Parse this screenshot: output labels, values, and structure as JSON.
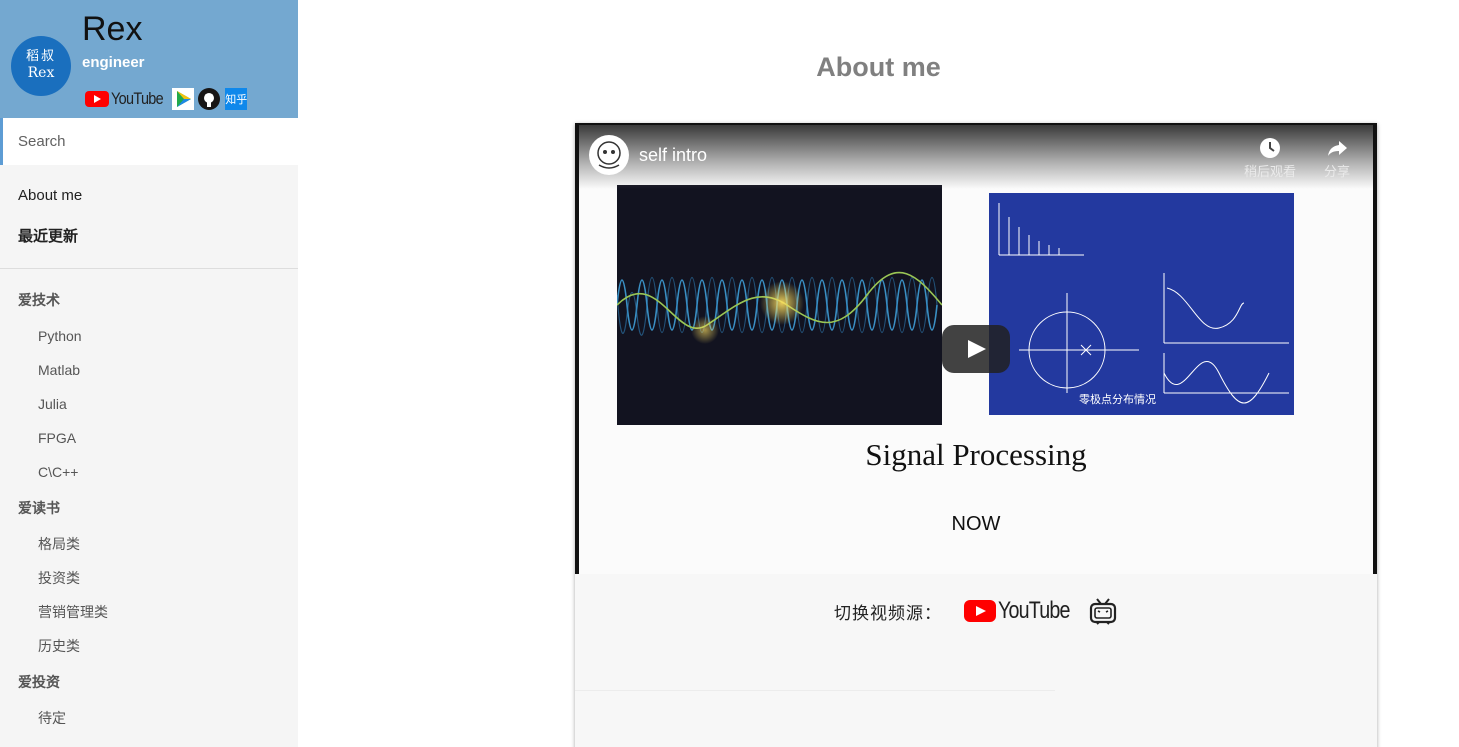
{
  "profile": {
    "avatar_line1": "稻叔",
    "avatar_line2": "Rex",
    "name": "Rex",
    "role": "engineer",
    "social": [
      {
        "name": "YouTube",
        "icon": "youtube-logo-icon"
      },
      {
        "name": "bilibili",
        "icon": "bilibili-play-icon"
      },
      {
        "name": "GitHub",
        "icon": "github-icon"
      },
      {
        "name": "知乎",
        "icon": "zhihu-icon"
      }
    ]
  },
  "search": {
    "placeholder": "Search"
  },
  "nav": {
    "top": [
      "About me",
      "最近更新"
    ],
    "groups": [
      {
        "title": "爱技术",
        "items": [
          "Python",
          "Matlab",
          "Julia",
          "FPGA",
          "C\\C++"
        ]
      },
      {
        "title": "爱读书",
        "items": [
          "格局类",
          "投资类",
          "营销管理类",
          "历史类"
        ]
      },
      {
        "title": "爱投资",
        "items": [
          "待定"
        ]
      }
    ]
  },
  "main": {
    "title": "About me",
    "video": {
      "title": "self intro",
      "watch_later": "稍后观看",
      "share": "分享",
      "heading": "Signal Processing",
      "subheading": "NOW",
      "formula_caption": "零极点分布情况"
    },
    "switch": {
      "label": "切换视频源：",
      "youtube_word": "YouTube"
    }
  },
  "colors": {
    "profile_bg": "#74a8d0",
    "avatar_bg": "#1a6fbe",
    "sidebar_bg": "#f5f5f5",
    "search_accent": "#5d9cd4",
    "youtube_red": "#ff0000",
    "zhihu_blue": "#0f88eb",
    "title_gray": "#808080"
  }
}
